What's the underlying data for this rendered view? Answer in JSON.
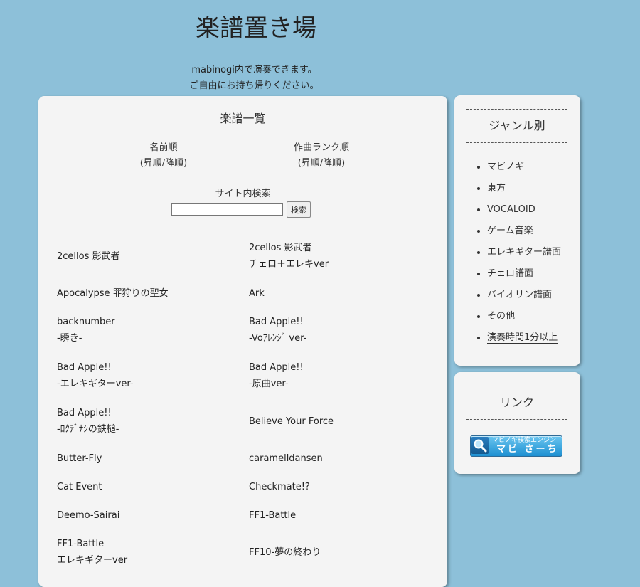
{
  "site": {
    "title": "楽譜置き場",
    "tagline_line1": "mabinogi内で演奏できます。",
    "tagline_line2": "ご自由にお持ち帰りください。"
  },
  "main": {
    "title": "楽譜一覧",
    "sort_name": {
      "label": "名前順",
      "options": "(昇順/降順)"
    },
    "sort_rank": {
      "label": "作曲ランク順",
      "options": "(昇順/降順)"
    },
    "search": {
      "label": "サイト内検索",
      "value": "",
      "button_label": "検索"
    },
    "songs": [
      [
        {
          "lines": [
            "2cellos 影武者"
          ]
        },
        {
          "lines": [
            "2cellos 影武者",
            "チェロ＋エレキver"
          ]
        }
      ],
      [
        {
          "lines": [
            "Apocalypse 罪狩りの聖女"
          ]
        },
        {
          "lines": [
            "Ark"
          ]
        }
      ],
      [
        {
          "lines": [
            "backnumber",
            "-瞬き-"
          ]
        },
        {
          "lines": [
            "Bad Apple!!",
            "-Voｱﾚﾝｼﾞ ver-"
          ]
        }
      ],
      [
        {
          "lines": [
            "Bad Apple!!",
            "-エレキギターver-"
          ]
        },
        {
          "lines": [
            "Bad Apple!!",
            "-原曲ver-"
          ]
        }
      ],
      [
        {
          "lines": [
            "Bad Apple!!",
            "-ﾛｸﾃﾞﾅｼの鉄槌-"
          ]
        },
        {
          "lines": [
            "Believe Your Force"
          ]
        }
      ],
      [
        {
          "lines": [
            "Butter-Fly"
          ]
        },
        {
          "lines": [
            "caramelldansen"
          ]
        }
      ],
      [
        {
          "lines": [
            "Cat Event"
          ]
        },
        {
          "lines": [
            "Checkmate!?"
          ]
        }
      ],
      [
        {
          "lines": [
            "Deemo-Sairai"
          ]
        },
        {
          "lines": [
            "FF1-Battle"
          ]
        }
      ],
      [
        {
          "lines": [
            "FF1-Battle",
            "エレキギターver"
          ]
        },
        {
          "lines": [
            "FF10-夢の終わり"
          ]
        }
      ]
    ]
  },
  "sidebar": {
    "genre_heading": "ジャンル別",
    "genres": [
      "マビノギ",
      "東方",
      "VOCALOID",
      "ゲーム音楽",
      "エレキギター譜面",
      "チェロ譜面",
      "バイオリン譜面",
      "その他",
      "演奏時間1分以上"
    ],
    "link_heading": "リンク",
    "banner": {
      "small_text": "マビノギ検索エンジン",
      "big_text": "マビ さーち",
      "icon": "magnifier-icon"
    }
  }
}
